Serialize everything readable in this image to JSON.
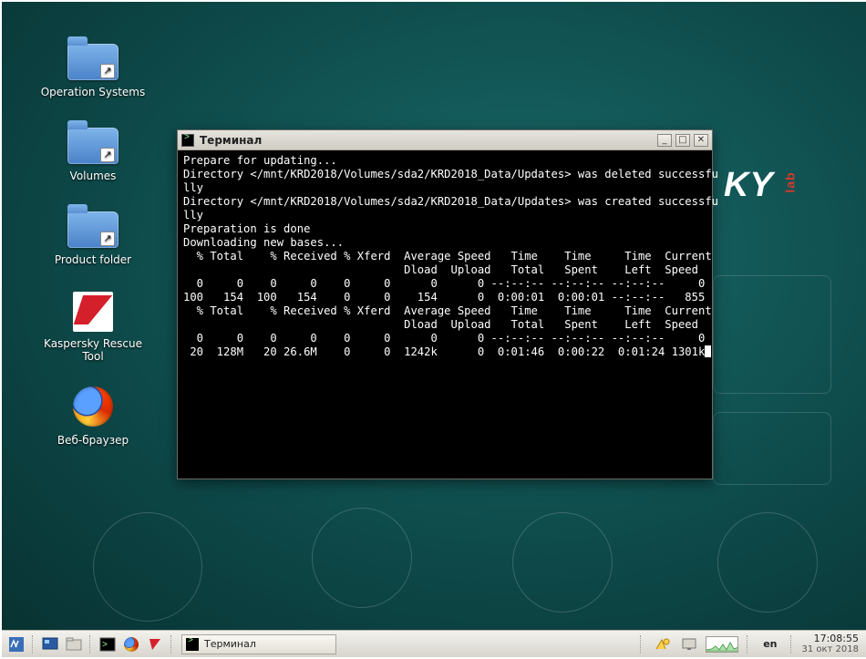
{
  "desktop_icons": [
    {
      "label": "Operation Systems",
      "name": "operation-systems",
      "type": "folder"
    },
    {
      "label": "Volumes",
      "name": "volumes",
      "type": "folder"
    },
    {
      "label": "Product folder",
      "name": "product-folder",
      "type": "folder"
    },
    {
      "label": "Kaspersky Rescue Tool",
      "name": "kaspersky-rescue-tool",
      "type": "kaspersky"
    },
    {
      "label": "Веб-браузер",
      "name": "web-browser",
      "type": "firefox"
    }
  ],
  "wallpaper_logo": {
    "text": "KY",
    "sub": "lab"
  },
  "terminal": {
    "title": "Терминал",
    "lines": [
      "Prepare for updating...",
      "Directory </mnt/KRD2018/Volumes/sda2/KRD2018_Data/Updates> was deleted successfu",
      "lly",
      "Directory </mnt/KRD2018/Volumes/sda2/KRD2018_Data/Updates> was created successfu",
      "lly",
      "Preparation is done",
      "Downloading new bases...",
      "  % Total    % Received % Xferd  Average Speed   Time    Time     Time  Current",
      "                                 Dload  Upload   Total   Spent    Left  Speed",
      "  0     0    0     0    0     0      0      0 --:--:-- --:--:-- --:--:--     0",
      "100   154  100   154    0     0    154      0  0:00:01  0:00:01 --:--:--   855",
      "  % Total    % Received % Xferd  Average Speed   Time    Time     Time  Current",
      "                                 Dload  Upload   Total   Spent    Left  Speed",
      "  0     0    0     0    0     0      0      0 --:--:-- --:--:-- --:--:--     0",
      " 20  128M   20 26.6M    0     0  1242k      0  0:01:46  0:00:22  0:01:24 1301k"
    ]
  },
  "taskbar": {
    "task_label": "Терминал",
    "lang": "en",
    "time": "17:08:55",
    "date": "31 окт 2018"
  }
}
